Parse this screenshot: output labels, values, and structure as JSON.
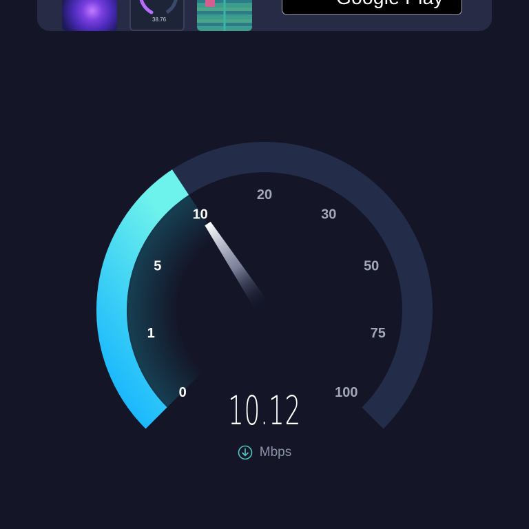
{
  "promo": {
    "thumbnail_2_value": "38.76",
    "store_button_label": "Google Play",
    "store_icon": "google-play-icon"
  },
  "gauge": {
    "scale_labels": [
      "0",
      "1",
      "5",
      "10",
      "20",
      "30",
      "50",
      "75",
      "100"
    ],
    "needle_value": 10.12,
    "colors": {
      "track": "#232d4a",
      "progress_start": "#0fb0ff",
      "progress_end": "#6ef2ec",
      "active_label": "#ffffff",
      "inactive_label": "#a3a8b8"
    }
  },
  "reading": {
    "speed": "10.12",
    "unit": "Mbps",
    "direction_icon": "download-arrow-icon"
  }
}
